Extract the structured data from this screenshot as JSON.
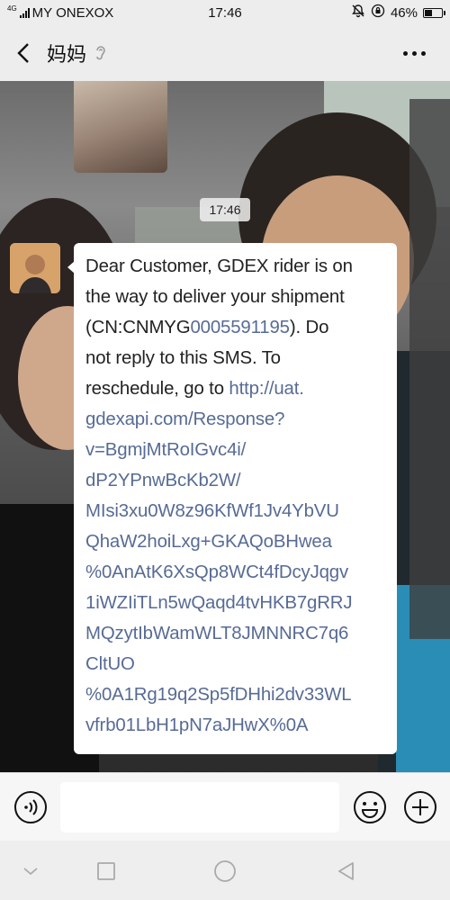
{
  "status_bar": {
    "network": "4G",
    "carrier": "MY ONEXOX",
    "time": "17:46",
    "battery_percent": "46%",
    "battery_level": 0.46
  },
  "header": {
    "title": "妈妈"
  },
  "chat": {
    "timestamp": "17:46",
    "message": {
      "line1": "Dear Customer, GDEX rider is on",
      "line2": "the way to deliver your shipment",
      "line3_pre": "(CN:CNMYG",
      "line3_link": "0005591195",
      "line3_post": "). Do",
      "line4": "not reply to this SMS. To",
      "line5_pre": "reschedule, go to ",
      "line5_link": "http://uat.",
      "url_lines": [
        "gdexapi.com/Response?",
        "v=BgmjMtRoIGvc4i/",
        "dP2YPnwBcKb2W/",
        "MIsi3xu0W8z96KfWf1Jv4YbVU",
        "QhaW2hoiLxg+GKAQoBHwea",
        "%0AnAtK6XsQp8WCt4fDcyJqgv",
        "1iWZIiTLn5wQaqd4tvHKB7gRRJ",
        "MQzytIbWamWLT8JMNNRC7q6",
        "CltUO",
        "%0A1Rg19q2Sp5fDHhi2dv33WL",
        "vfrb01LbH1pN7aJHwX%0A"
      ]
    }
  },
  "input": {
    "placeholder": ""
  },
  "colors": {
    "bubble": "#ffffff",
    "link": "#576b95",
    "background_top": "#ededed"
  },
  "icons": {
    "back": "chevron-left-icon",
    "ear": "ear-icon",
    "more": "more-icon",
    "voice": "voice-icon",
    "emoji": "emoji-icon",
    "plus": "plus-icon"
  }
}
